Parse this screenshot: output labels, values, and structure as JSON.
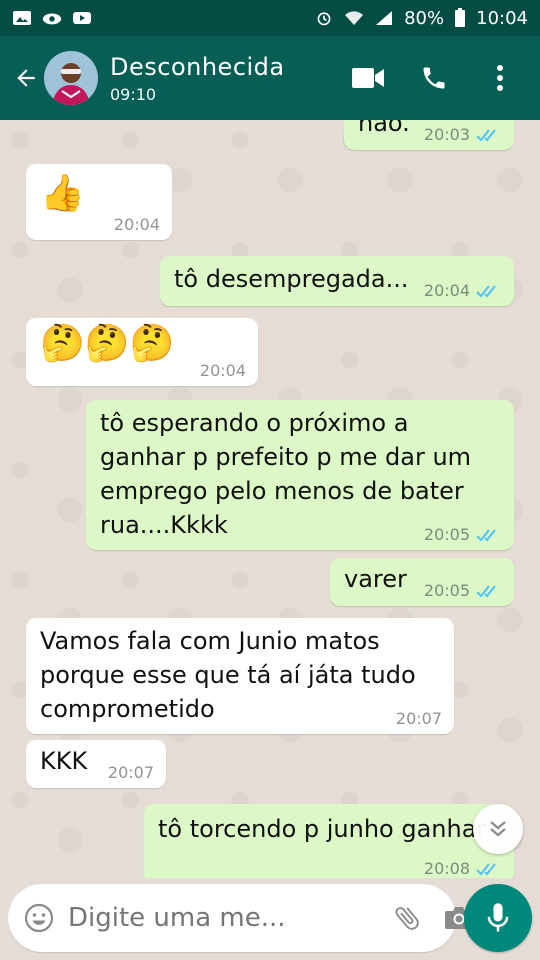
{
  "status_bar": {
    "battery": "80%",
    "time": "10:04"
  },
  "header": {
    "contact_name": "Desconhecida",
    "subtitle": "09:10"
  },
  "messages": [
    {
      "dir": "out",
      "text": "não.",
      "time": "20:03",
      "read": true
    },
    {
      "dir": "in",
      "text": "👍",
      "time": "20:04"
    },
    {
      "dir": "out",
      "text": "tô desempregada...",
      "time": "20:04",
      "read": true
    },
    {
      "dir": "in",
      "text": "🤔🤔🤔",
      "time": "20:04"
    },
    {
      "dir": "out",
      "text": "tô esperando o próximo a ganhar p prefeito p me dar um emprego pelo menos de bater rua....Kkkk",
      "time": "20:05",
      "read": true
    },
    {
      "dir": "out",
      "text": "varer",
      "time": "20:05",
      "read": true
    },
    {
      "dir": "in",
      "text": "Vamos fala com Junio matos porque esse que tá aí játa tudo comprometido",
      "time": "20:07"
    },
    {
      "dir": "in",
      "text": "KKK",
      "time": "20:07"
    },
    {
      "dir": "out",
      "text": "tô torcendo p junho ganhar",
      "time": "20:08",
      "read": true
    }
  ],
  "composer": {
    "placeholder": "Digite uma me..."
  },
  "colors": {
    "header": "#075e54",
    "status_bar": "#054d44",
    "outgoing": "#dcf8c6",
    "incoming": "#ffffff",
    "ticks": "#4fc3f7",
    "accent": "#00897b"
  },
  "icons": [
    "back-arrow-icon",
    "video-call-icon",
    "phone-icon",
    "more-vert-icon",
    "emoji-icon",
    "attach-icon",
    "camera-icon",
    "mic-icon",
    "scroll-down-icon"
  ]
}
